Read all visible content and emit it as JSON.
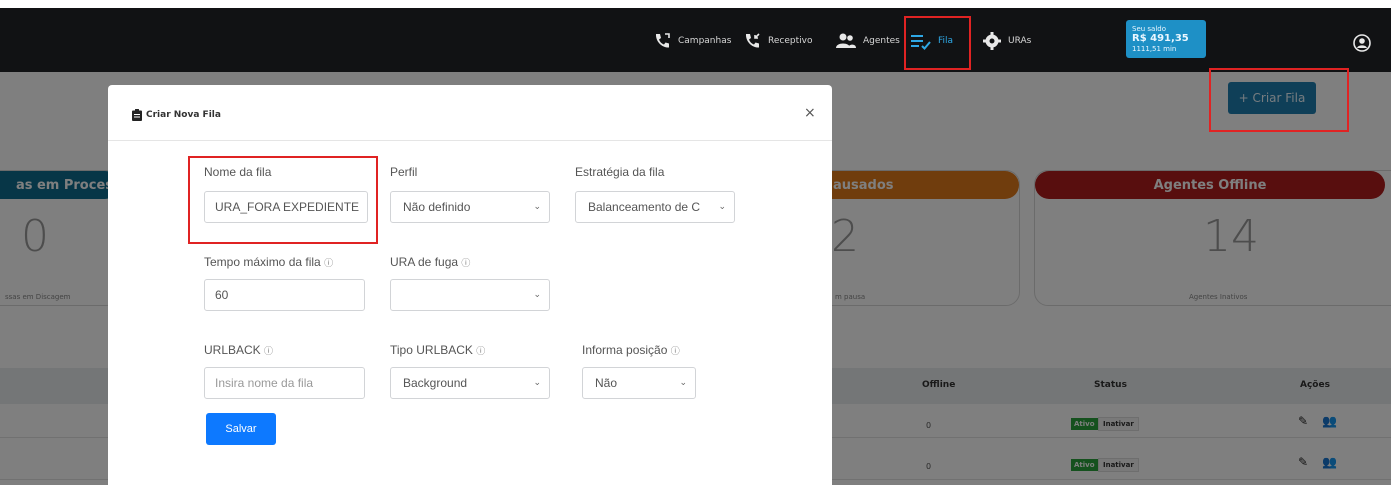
{
  "nav": {
    "items": [
      {
        "label": "Campanhas",
        "icon": "phone-outgoing-icon"
      },
      {
        "label": "Receptivo",
        "icon": "phone-incoming-icon"
      },
      {
        "label": "Agentes",
        "icon": "users-icon"
      },
      {
        "label": "Fila",
        "icon": "queue-list-icon"
      },
      {
        "label": "URAs",
        "icon": "gear-icon"
      }
    ],
    "balance": {
      "title": "Seu saldo",
      "amount": "R$ 491,35",
      "minutes": "1111,51 min"
    },
    "colors": {
      "bg": "#111214",
      "accent": "#1e90c6",
      "highlight": "#e02323"
    }
  },
  "page": {
    "create_button": "+ Criar Fila",
    "cards": [
      {
        "header": "as em Proces",
        "value": "0",
        "sub": "ssas em Discagem",
        "color": "#0f6d8f"
      },
      {
        "header": "ausados",
        "value": "2",
        "sub": "m pausa",
        "color": "#e07a1b"
      },
      {
        "header": "Agentes Offline",
        "value": "14",
        "sub": "Agentes Inativos",
        "color": "#b01c1c"
      }
    ],
    "table": {
      "headers": {
        "offline": "Offline",
        "status": "Status",
        "actions": "Ações"
      },
      "rows": [
        {
          "offline": "0",
          "active": "Ativo",
          "deactivate": "Inativar"
        },
        {
          "offline": "0",
          "active": "Ativo",
          "deactivate": "Inativar"
        }
      ]
    }
  },
  "modal": {
    "title": "Criar Nova Fila",
    "close": "×",
    "fields": {
      "name": {
        "label": "Nome da fila",
        "value": "URA_FORA EXPEDIENTE"
      },
      "profile": {
        "label": "Perfil",
        "value": "Não definido"
      },
      "strategy": {
        "label": "Estratégia da fila",
        "value": "Balanceamento de C"
      },
      "max_time": {
        "label": "Tempo máximo da fila",
        "value": "60"
      },
      "escape_ura": {
        "label": "URA de fuga",
        "value": ""
      },
      "urlback": {
        "label": "URLBACK",
        "placeholder": "Insira nome da fila"
      },
      "urlback_type": {
        "label": "Tipo URLBACK",
        "value": "Background"
      },
      "inform_position": {
        "label": "Informa posição",
        "value": "Não"
      }
    },
    "help_glyph": "ⓘ",
    "save": "Salvar"
  }
}
